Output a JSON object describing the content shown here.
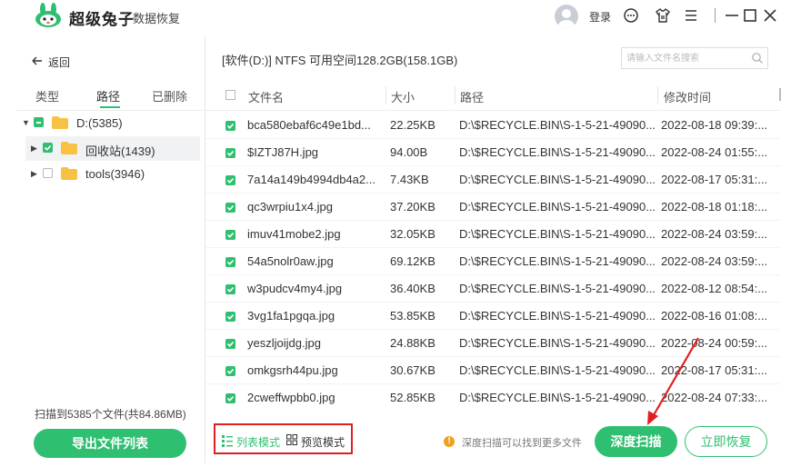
{
  "app": {
    "name": "超级兔子",
    "subtitle": "数据恢复",
    "login_label": "登录"
  },
  "nav": {
    "back_label": "返回"
  },
  "left_tabs": [
    "类型",
    "路径",
    "已删除"
  ],
  "tree": [
    {
      "label": "D:(5385)",
      "checked": "partial",
      "expanded": true
    },
    {
      "label": "回收站(1439)",
      "checked": "on",
      "expanded": false
    },
    {
      "label": "tools(3946)",
      "checked": "off",
      "expanded": false
    }
  ],
  "scan_summary": "扫描到5385个文件(共84.86MB)",
  "export_label": "导出文件列表",
  "path_info": "[软件(D:)] NTFS 可用空间128.2GB(158.1GB)",
  "search": {
    "placeholder": "请输入文件名搜索"
  },
  "table": {
    "headers": [
      "文件名",
      "大小",
      "路径",
      "修改时间"
    ],
    "rows": [
      {
        "name": "bca580ebaf6c49e1bd...",
        "size": "22.25KB",
        "path": "D:\\$RECYCLE.BIN\\S-1-5-21-49090...",
        "modified": "2022-08-18 09:39:..."
      },
      {
        "name": "$IZTJ87H.jpg",
        "size": "94.00B",
        "path": "D:\\$RECYCLE.BIN\\S-1-5-21-49090...",
        "modified": "2022-08-24 01:55:..."
      },
      {
        "name": "7a14a149b4994db4a2...",
        "size": "7.43KB",
        "path": "D:\\$RECYCLE.BIN\\S-1-5-21-49090...",
        "modified": "2022-08-17 05:31:..."
      },
      {
        "name": "qc3wrpiu1x4.jpg",
        "size": "37.20KB",
        "path": "D:\\$RECYCLE.BIN\\S-1-5-21-49090...",
        "modified": "2022-08-18 01:18:..."
      },
      {
        "name": "imuv41mobe2.jpg",
        "size": "32.05KB",
        "path": "D:\\$RECYCLE.BIN\\S-1-5-21-49090...",
        "modified": "2022-08-24 03:59:..."
      },
      {
        "name": "54a5nolr0aw.jpg",
        "size": "69.12KB",
        "path": "D:\\$RECYCLE.BIN\\S-1-5-21-49090...",
        "modified": "2022-08-24 03:59:..."
      },
      {
        "name": "w3pudcv4my4.jpg",
        "size": "36.40KB",
        "path": "D:\\$RECYCLE.BIN\\S-1-5-21-49090...",
        "modified": "2022-08-12 08:54:..."
      },
      {
        "name": "3vg1fa1pgqa.jpg",
        "size": "53.85KB",
        "path": "D:\\$RECYCLE.BIN\\S-1-5-21-49090...",
        "modified": "2022-08-16 01:08:..."
      },
      {
        "name": "yeszljoijdg.jpg",
        "size": "24.88KB",
        "path": "D:\\$RECYCLE.BIN\\S-1-5-21-49090...",
        "modified": "2022-08-24 00:59:..."
      },
      {
        "name": "omkgsrh44pu.jpg",
        "size": "30.67KB",
        "path": "D:\\$RECYCLE.BIN\\S-1-5-21-49090...",
        "modified": "2022-08-17 05:31:..."
      },
      {
        "name": "2cweffwpbb0.jpg",
        "size": "52.85KB",
        "path": "D:\\$RECYCLE.BIN\\S-1-5-21-49090...",
        "modified": "2022-08-24 07:33:..."
      }
    ]
  },
  "view_modes": {
    "list": "列表模式",
    "preview": "预览模式"
  },
  "hint": "深度扫描可以找到更多文件",
  "deep_scan_label": "深度扫描",
  "recover_label": "立即恢复",
  "colors": {
    "accent": "#2fbf71",
    "annotation": "#e02020",
    "hint": "#f0a020"
  },
  "icons": [
    "rabbit-logo-icon",
    "user-avatar-icon",
    "feedback-icon",
    "tshirt-skin-icon",
    "menu-icon",
    "minimize-icon",
    "maximize-icon",
    "close-icon",
    "back-arrow-icon",
    "folder-icon",
    "search-icon",
    "list-view-icon",
    "grid-view-icon",
    "info-icon"
  ]
}
